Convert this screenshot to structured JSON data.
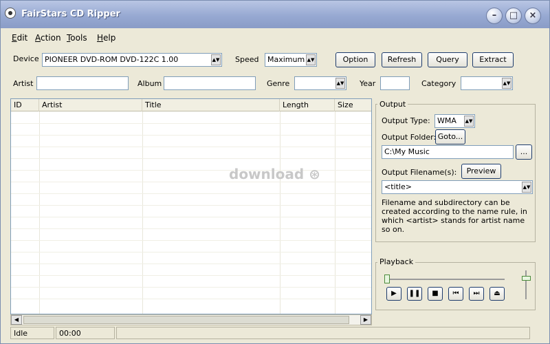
{
  "window": {
    "title": "FairStars CD Ripper"
  },
  "menu": [
    {
      "key": "E",
      "rest": "dit"
    },
    {
      "key": "A",
      "rest": "ction"
    },
    {
      "key": "T",
      "rest": "ools"
    },
    {
      "key": "H",
      "rest": "elp"
    }
  ],
  "toolbar": {
    "device_label": "Device",
    "device_value": "PIONEER DVD-ROM DVD-122C 1.00",
    "speed_label": "Speed",
    "speed_value": "Maximum",
    "option": "Option",
    "refresh": "Refresh",
    "query": "Query",
    "extract": "Extract"
  },
  "info": {
    "artist": "Artist",
    "album": "Album",
    "genre": "Genre",
    "year": "Year",
    "category": "Category"
  },
  "grid": {
    "columns": [
      "ID",
      "Artist",
      "Title",
      "Length",
      "Size"
    ]
  },
  "watermark": "download",
  "output": {
    "title": "Output",
    "type_label": "Output Type:",
    "type_value": "WMA",
    "folder_label": "Output Folder:",
    "goto": "Goto...",
    "folder_value": "C:\\My Music",
    "browse": "...",
    "filename_label": "Output Filename(s):",
    "preview": "Preview",
    "filename_value": "<title>",
    "note": "Filename and subdirectory can be created according to the name rule, in which <artist> stands for artist name so on."
  },
  "playback": {
    "title": "Playback"
  },
  "status": {
    "state": "Idle",
    "time": "00:00",
    "extra": ""
  }
}
